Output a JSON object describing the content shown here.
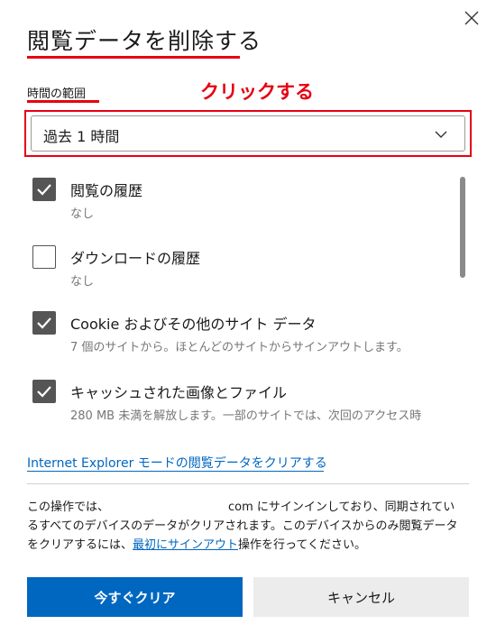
{
  "dialog": {
    "title": "閲覧データを削除する",
    "time_range_label": "時間の範囲",
    "annotation": "クリックする",
    "time_range_value": "過去 1 時間",
    "options": [
      {
        "label": "閲覧の履歴",
        "sub": "なし",
        "checked": true
      },
      {
        "label": "ダウンロードの履歴",
        "sub": "なし",
        "checked": false
      },
      {
        "label": "Cookie およびその他のサイト データ",
        "sub": "7 個のサイトから。ほとんどのサイトからサインアウトします。",
        "checked": true
      },
      {
        "label": "キャッシュされた画像とファイル",
        "sub": "280 MB 未満を解放します。一部のサイトでは、次回のアクセス時",
        "checked": true
      }
    ],
    "ie_link": "Internet Explorer モードの閲覧データをクリアする",
    "info": {
      "line1_prefix": "この操作では、",
      "line1_suffix": "com にサインインしており、同期されてい",
      "line2": "るすべてのデバイスのデータがクリアされます。このデバイスからのみ閲覧データ",
      "line3_prefix": "をクリアするには、",
      "line3_link": "最初にサインアウト",
      "line3_suffix": "操作を行ってください。"
    },
    "clear_button": "今すぐクリア",
    "cancel_button": "キャンセル"
  },
  "colors": {
    "accent_blue": "#0067c0",
    "annotation_red": "#e60012",
    "checkbox_gray": "#555555"
  },
  "icons": {
    "close": "close-icon",
    "chevron": "chevron-down-icon",
    "check": "checkmark-icon"
  }
}
